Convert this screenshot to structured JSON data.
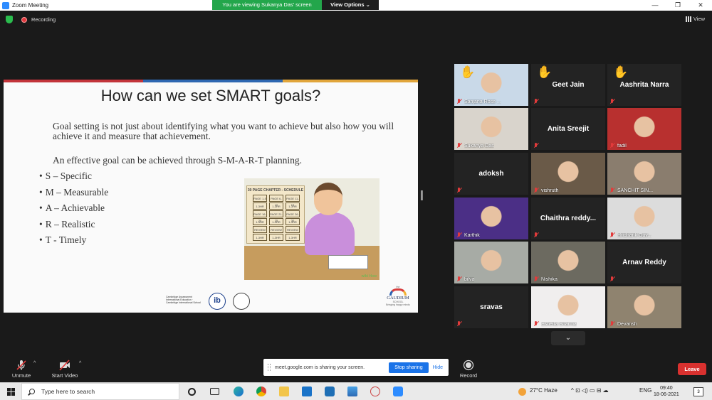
{
  "window": {
    "title": "Zoom Meeting",
    "min": "—",
    "max": "❐",
    "close": "✕"
  },
  "banner": {
    "message": "You are viewing Sukanya Das' screen",
    "view_options": "View Options ⌄"
  },
  "status": {
    "recording": "Recording",
    "view": "View"
  },
  "slide": {
    "title": "How can we set SMART goals?",
    "para1": "Goal setting is not just about identifying what you want to achieve but also how you will achieve it and measure that achievement.",
    "para2": "An effective goal can be achieved through S-M-A-R-T planning.",
    "list": [
      "S – Specific",
      "M – Measurable",
      "A – Achievable",
      "R – Realistic",
      "T - Timely"
    ],
    "illustration": {
      "heading": "30 PAGE CHAPTER - SCHEDULE",
      "cells": [
        "PAGE 1-5",
        "PAGE 6-10",
        "PAGE 11-15",
        "1-3HR",
        "1-3HR",
        "1-3HR",
        "PAGE 16-20",
        "PAGE 21-25",
        "PAGE 26-30",
        "1-3HR",
        "1-3HR",
        "1-3HR",
        "REVIEW",
        "REVIEW",
        "REVIEW",
        "1-3HR",
        "1-3HR",
        "1-3HR"
      ],
      "watermark": "wiki How"
    },
    "logos": {
      "cambridge": "Cambridge Assessment International Education · Cambridge International School",
      "ib": "ib",
      "gaudium": "GAUDIUM",
      "gaudium_sub": "SCHOOL",
      "gaudium_pre": "the",
      "gaudium_tag": "Bringing happy minds"
    }
  },
  "participants": [
    {
      "name": "Sanjana Rose ...",
      "video": true,
      "hand": true,
      "color": "#c9d9e8"
    },
    {
      "name": "Geet Jain",
      "video": false,
      "hand": true
    },
    {
      "name": "Aashrita Narra",
      "video": false,
      "hand": true
    },
    {
      "name": "Sukanya Das",
      "video": true,
      "active": true,
      "color": "#d9d4cc"
    },
    {
      "name": "Anita Sreejit",
      "video": false
    },
    {
      "name": "fadil",
      "video": true,
      "color": "#b8302f"
    },
    {
      "name": "adoksh",
      "video": false
    },
    {
      "name": "vishruth",
      "video": true,
      "color": "#6a5a48"
    },
    {
      "name": "SANCHIT SIN...",
      "video": true,
      "color": "#8a7d6e"
    },
    {
      "name": "Karthik",
      "video": true,
      "color": "#4b2f86"
    },
    {
      "name": "Chaithra  reddy...",
      "video": false
    },
    {
      "name": "Hridhank Guv...",
      "video": true,
      "color": "#dcdcdc"
    },
    {
      "name": "bilva",
      "video": true,
      "color": "#a7aba5"
    },
    {
      "name": "Nishika",
      "video": true,
      "color": "#6c6a60"
    },
    {
      "name": "Arnav Reddy",
      "video": false
    },
    {
      "name": "sravas",
      "video": false
    },
    {
      "name": "Esheita Sharma",
      "video": true,
      "color": "#f0eeee"
    },
    {
      "name": "Devansh",
      "video": true,
      "color": "#8f836f"
    }
  ],
  "gallery": {
    "scroll_down": "⌄"
  },
  "toolbar": {
    "unmute": "Unmute",
    "start_video": "Start Video",
    "record": "Record",
    "leave": "Leave",
    "caret": "^"
  },
  "share_bar": {
    "text": "meet.google.com is sharing your screen.",
    "stop": "Stop sharing",
    "hide": "Hide"
  },
  "taskbar": {
    "search_placeholder": "Type here to search",
    "weather": "27°C  Haze",
    "lang": "ENG",
    "time": "09:40",
    "date": "18-06-2021",
    "notifications": "3",
    "tray_icons": "^  ⊡  ◁)  ▭  ⊟  ☁"
  },
  "colors": {
    "accent": "#2d8cff",
    "banner_green": "#23a64b",
    "leave_red": "#d9312f",
    "stop_blue": "#1a73e8",
    "hand_yellow": "#f6c21c",
    "active_outline": "#d6d04a"
  }
}
